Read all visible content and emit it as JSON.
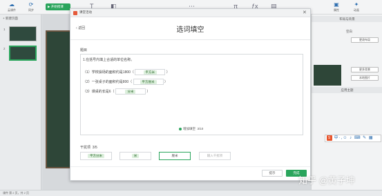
{
  "toolbar": {
    "items": [
      {
        "label": "云课件",
        "icon": "cloud-icon"
      },
      {
        "label": "同步",
        "icon": "sync-icon"
      }
    ],
    "start_label": "开始授课",
    "right_items": [
      {
        "label": "属性",
        "icon": "properties-icon"
      },
      {
        "label": "动画",
        "icon": "animation-icon"
      }
    ]
  },
  "slides": {
    "new_page_label": "+ 新建页面",
    "pages": [
      "1",
      "2"
    ]
  },
  "right_panel": {
    "section_layout": "布局与背景",
    "layout_name": "空白",
    "change_layout": "更改布局",
    "more_bg": "更多背景",
    "local_image": "本地图片",
    "apply_theme": "应用主题"
  },
  "dialog": {
    "app_title": "课堂活动",
    "close": "✕",
    "back": "返回",
    "heading": "选词填空",
    "question_label": "题目",
    "prompt": "1.在括号内填上合适的单位名称。",
    "items": [
      {
        "prefix": "（1）学校操场的面积约是1800（",
        "answer": "平方米",
        "suffix": "）"
      },
      {
        "prefix": "（2）一张桌子的面积约是800（",
        "answer": "平方厘米",
        "suffix": "）"
      },
      {
        "prefix": "（3）课桌的长是6（",
        "answer": "分米",
        "suffix": "）"
      }
    ],
    "add_blank": "增加填空",
    "blank_count": "3/10",
    "distractor_label": "干扰项",
    "distractor_count": "3/5",
    "distractors": [
      "平方分米",
      "米",
      "厘米"
    ],
    "add_distractor": "输入干扰项",
    "hint_button": "提示",
    "done_button": "完成"
  },
  "status_bar": {
    "text": "课件 第 2 页，共 2 页"
  },
  "watermark": "知乎 @黄子坤",
  "colors": {
    "accent": "#2aa55c",
    "board": "#2e4638"
  }
}
